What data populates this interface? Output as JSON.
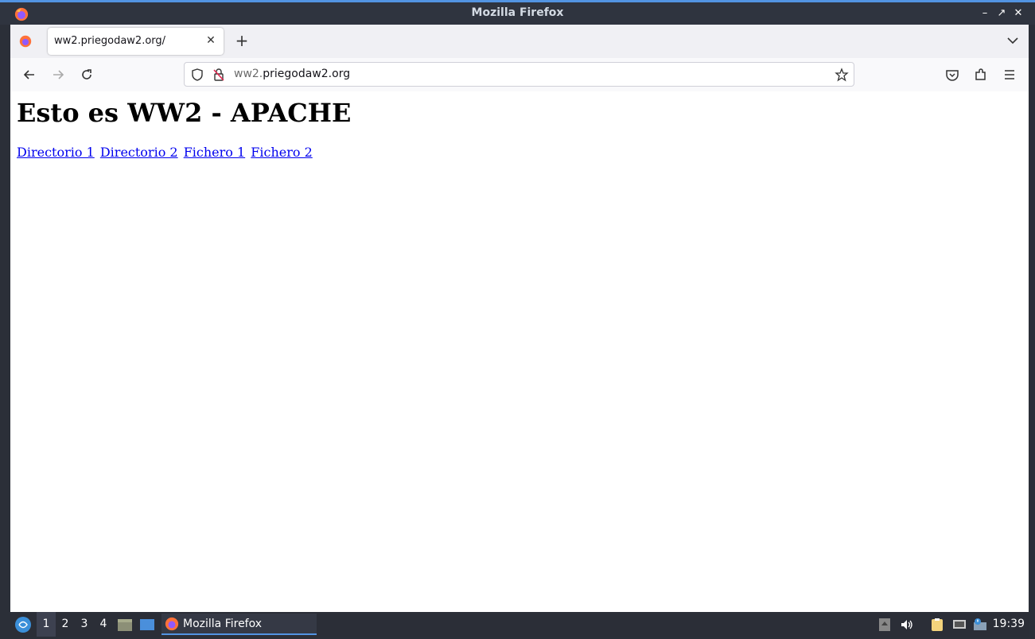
{
  "window": {
    "title": "Mozilla Firefox"
  },
  "tabs": [
    {
      "title": "ww2.priegodaw2.org/"
    }
  ],
  "urlbar": {
    "url_dim": "ww2.",
    "url_main": "priegodaw2.org"
  },
  "page": {
    "heading": "Esto es WW2 - APACHE",
    "links": [
      "Directorio 1",
      "Directorio 2",
      "Fichero 1",
      "Fichero 2"
    ]
  },
  "taskbar": {
    "workspaces": [
      "1",
      "2",
      "3",
      "4"
    ],
    "active_workspace": "1",
    "task_label": "Mozilla Firefox",
    "clock": "19:39"
  },
  "colors": {
    "accent": "#5294e2",
    "link": "#0000ee"
  }
}
